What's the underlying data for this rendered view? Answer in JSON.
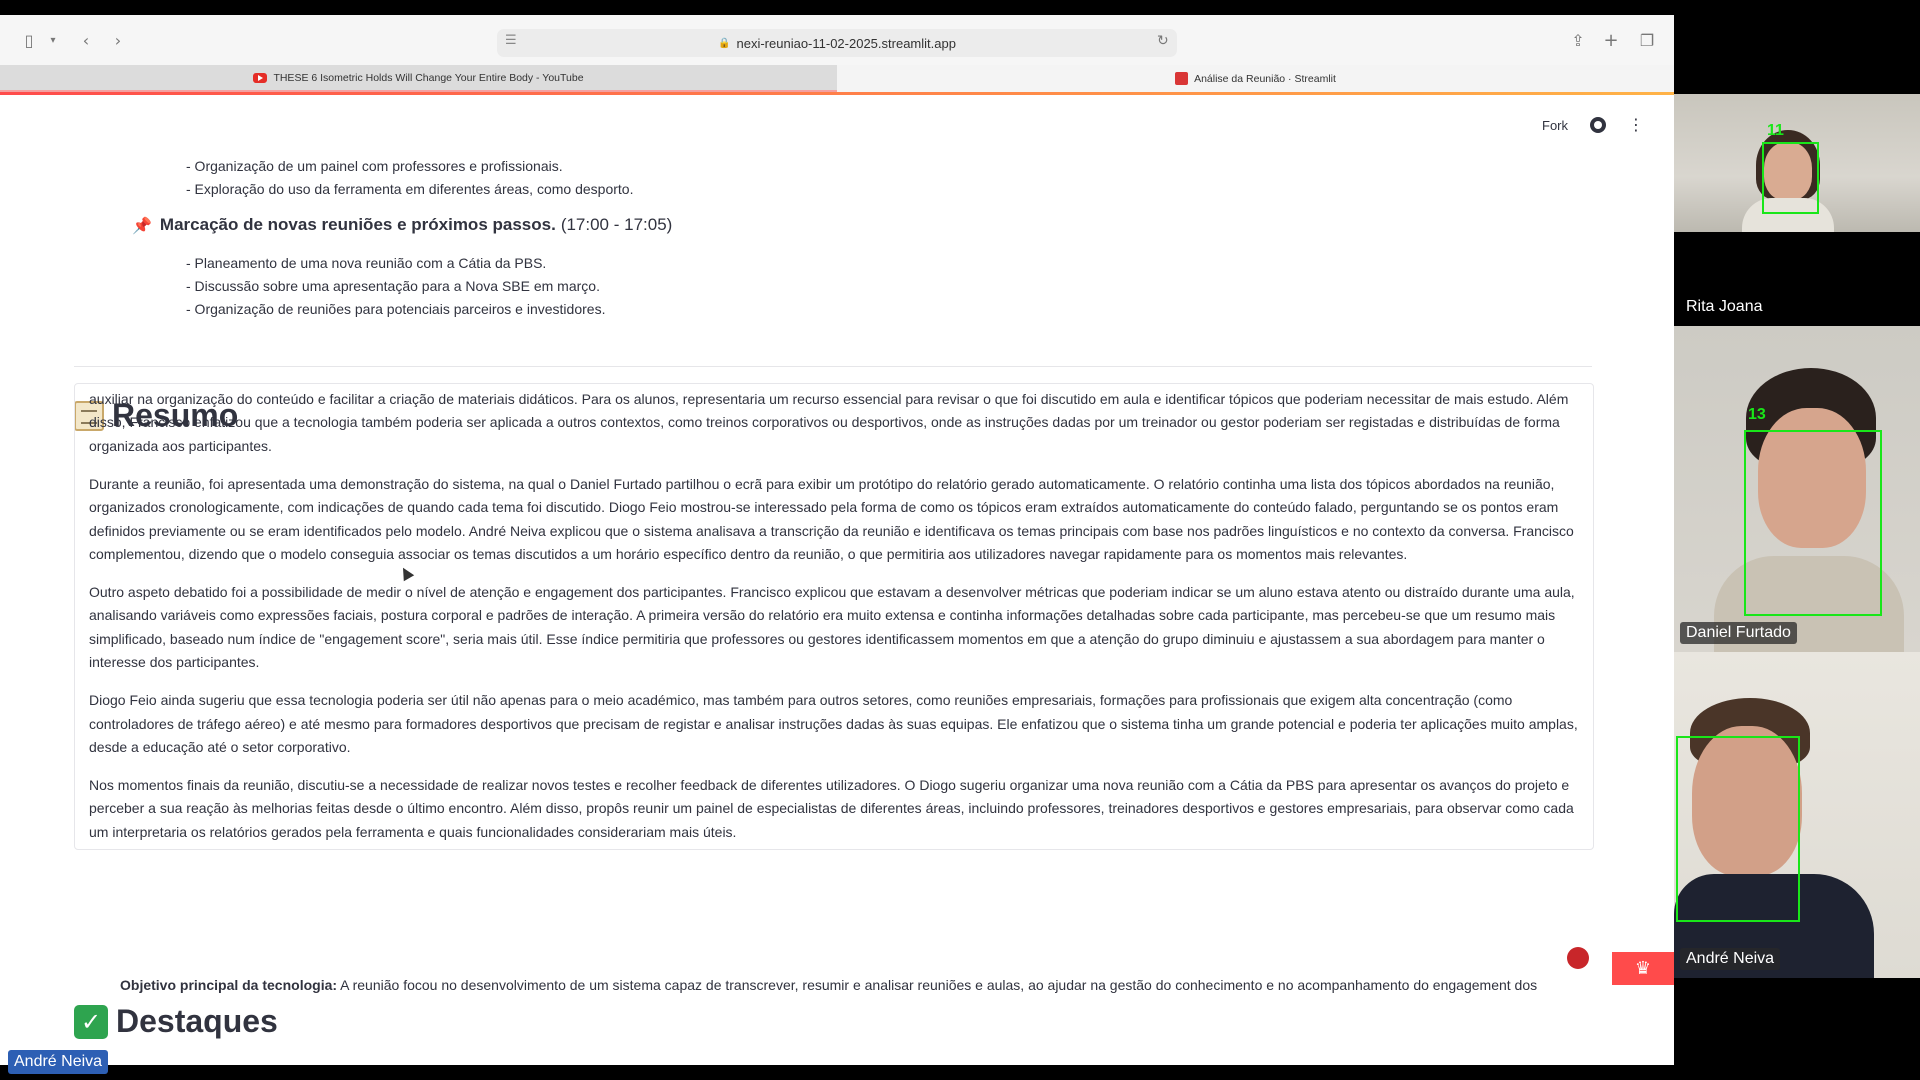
{
  "browser": {
    "url": "nexi-reuniao-11-02-2025.streamlit.app",
    "tabs": [
      {
        "label": "THESE 6 Isometric Holds Will Change Your Entire Body - YouTube"
      },
      {
        "label": "Análise da Reunião · Streamlit"
      }
    ]
  },
  "app": {
    "header": {
      "fork_label": "Fork"
    },
    "agenda": {
      "prev_bullets": [
        "- Organização de um painel com professores e profissionais.",
        "- Exploração do uso da ferramenta em diferentes áreas, como desporto."
      ],
      "heading_bold": "Marcação de novas reuniões e próximos passos.",
      "heading_time": "(17:00 - 17:05)",
      "bullets": [
        "- Planeamento de uma nova reunião com a Cátia da PBS.",
        "- Discussão sobre uma apresentação para a Nova SBE em março.",
        "- Organização de reuniões para potenciais parceiros e investidores."
      ]
    },
    "resumo": {
      "title": "Resumo",
      "paragraphs": [
        "auxiliar na organização do conteúdo e facilitar a criação de materiais didáticos. Para os alunos, representaria um recurso essencial para revisar o que foi discutido em aula e identificar tópicos que poderiam necessitar de mais estudo. Além disso, Francisco enfatizou que a tecnologia também poderia ser aplicada a outros contextos, como treinos corporativos ou desportivos, onde as instruções dadas por um treinador ou gestor poderiam ser registadas e distribuídas de forma organizada aos participantes.",
        "Durante a reunião, foi apresentada uma demonstração do sistema, na qual o Daniel Furtado partilhou o ecrã para exibir um protótipo do relatório gerado automaticamente. O relatório continha uma lista dos tópicos abordados na reunião, organizados cronologicamente, com indicações de quando cada tema foi discutido. Diogo Feio mostrou-se interessado pela forma de como os tópicos eram extraídos automaticamente do conteúdo falado, perguntando se os pontos eram definidos previamente ou se eram identificados pelo modelo. André Neiva explicou que o sistema analisava a transcrição da reunião e identificava os temas principais com base nos padrões linguísticos e no contexto da conversa. Francisco complementou, dizendo que o modelo conseguia associar os temas discutidos a um horário específico dentro da reunião, o que permitiria aos utilizadores navegar rapidamente para os momentos mais relevantes.",
        "Outro aspeto debatido foi a possibilidade de medir o nível de atenção e engagement dos participantes. Francisco explicou que estavam a desenvolver métricas que poderiam indicar se um aluno estava atento ou distraído durante uma aula, analisando variáveis como expressões faciais, postura corporal e padrões de interação. A primeira versão do relatório era muito extensa e continha informações detalhadas sobre cada participante, mas percebeu-se que um resumo mais simplificado, baseado num índice de \"engagement score\", seria mais útil. Esse índice permitiria que professores ou gestores identificassem momentos em que a atenção do grupo diminuiu e ajustassem a sua abordagem para manter o interesse dos participantes.",
        "Diogo Feio ainda sugeriu que essa tecnologia poderia ser útil não apenas para o meio académico, mas também para outros setores, como reuniões empresariais, formações para profissionais que exigem alta concentração (como controladores de tráfego aéreo) e até mesmo para formadores desportivos que precisam de registar e analisar instruções dadas às suas equipas. Ele enfatizou que o sistema tinha um grande potencial e poderia ter aplicações muito amplas, desde a educação até o setor corporativo.",
        "Nos momentos finais da reunião, discutiu-se a necessidade de realizar novos testes e recolher feedback de diferentes utilizadores. O Diogo sugeriu organizar uma nova reunião com a Cátia da PBS para apresentar os avanços do projeto e perceber a sua reação às melhorias feitas desde o último encontro. Além disso, propôs reunir um painel de especialistas de diferentes áreas, incluindo professores, treinadores desportivos e gestores empresariais, para observar como cada um interpretaria os relatórios gerados pela ferramenta e quais funcionalidades considerariam mais úteis."
      ]
    },
    "destaques": {
      "title": "Destaques",
      "first_item_bold": "Objetivo principal da tecnologia:",
      "first_item_text": " A reunião focou no desenvolvimento de um sistema capaz de transcrever, resumir e analisar reuniões e aulas, ao ajudar na gestão do conhecimento e no acompanhamento do engagement dos"
    }
  },
  "video_call": {
    "participants": [
      {
        "name": "Rita Joana",
        "detection_id": "11"
      },
      {
        "name": "Daniel Furtado",
        "detection_id": "13"
      },
      {
        "name": "André Neiva",
        "detection_id": ""
      }
    ],
    "self_label": "André Neiva"
  },
  "colors": {
    "accent": "#ff4b4b",
    "detection": "#19e619",
    "text": "#31333f"
  }
}
